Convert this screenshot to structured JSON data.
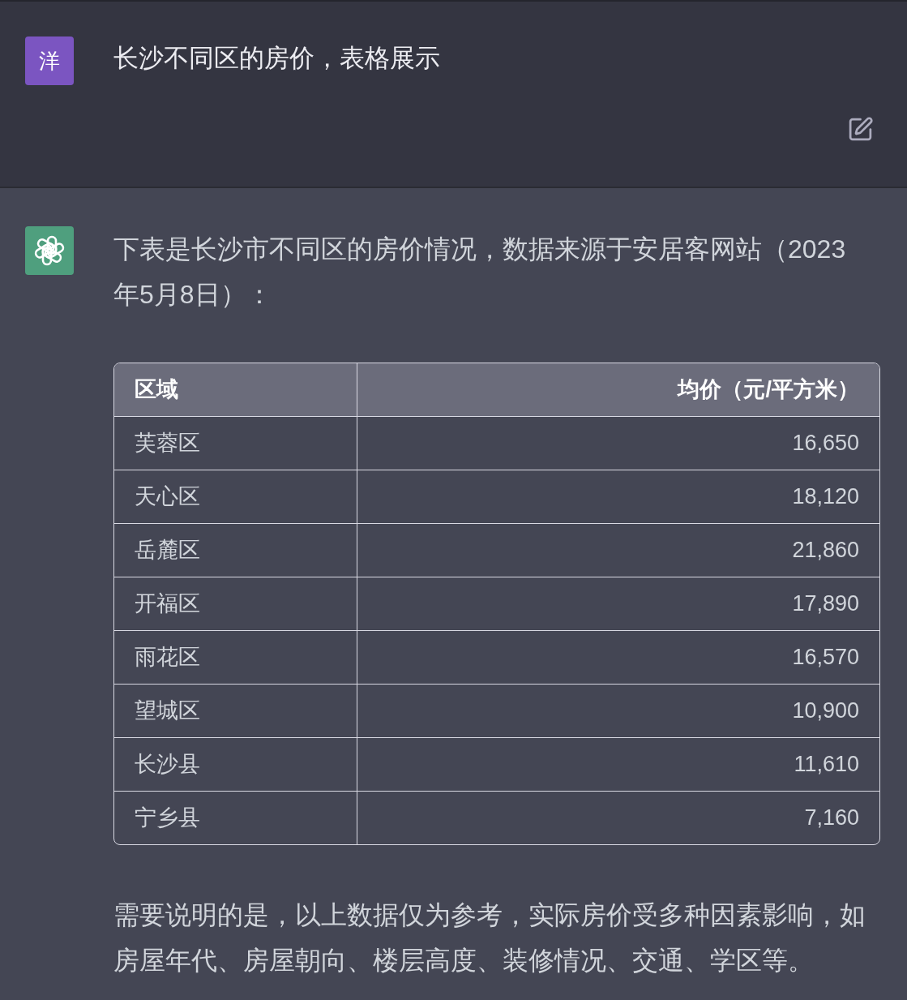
{
  "user_message": {
    "avatar": "洋",
    "text": "长沙不同区的房价，表格展示"
  },
  "assistant_message": {
    "intro": "下表是长沙市不同区的房价情况，数据来源于安居客网站（2023年5月8日）：",
    "table": {
      "columns": [
        "区域",
        "均价（元/平方米）"
      ],
      "rows": [
        [
          "芙蓉区",
          "16,650"
        ],
        [
          "天心区",
          "18,120"
        ],
        [
          "岳麓区",
          "21,860"
        ],
        [
          "开福区",
          "17,890"
        ],
        [
          "雨花区",
          "16,570"
        ],
        [
          "望城区",
          "10,900"
        ],
        [
          "长沙县",
          "11,610"
        ],
        [
          "宁乡县",
          "7,160"
        ]
      ]
    },
    "note": "需要说明的是，以上数据仅为参考，实际房价受多种因素影响，如房屋年代、房屋朝向、楼层高度、装修情况、交通、学区等。"
  }
}
